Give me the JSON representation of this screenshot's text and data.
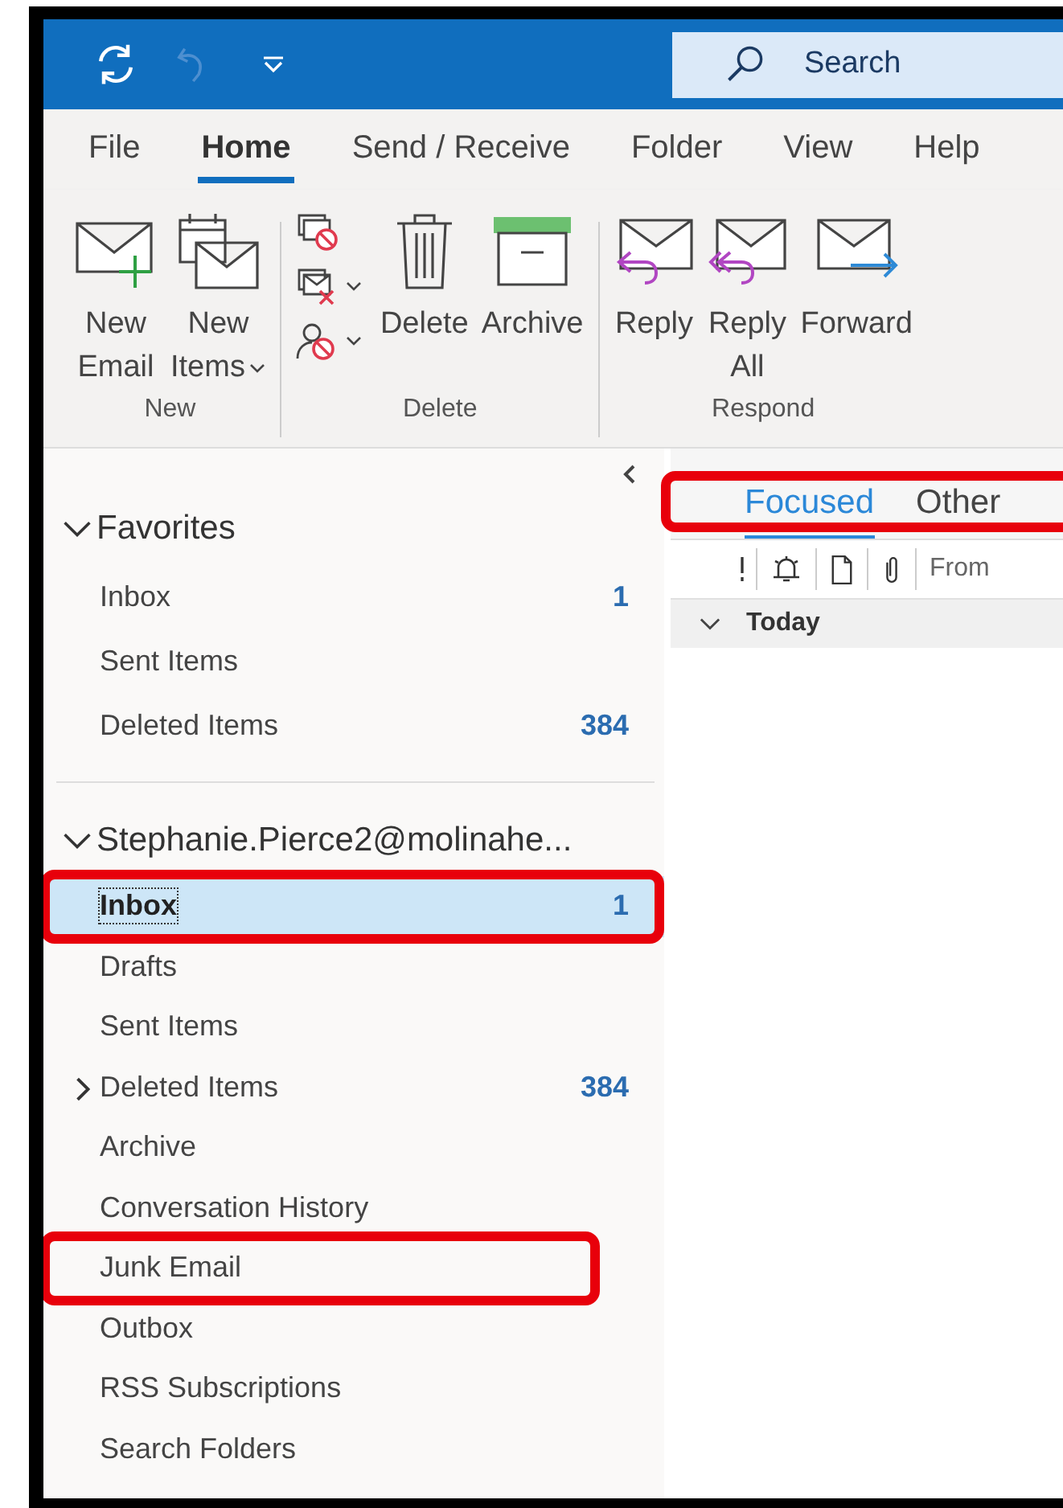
{
  "search": {
    "placeholder": "Search"
  },
  "menu_tabs": [
    {
      "label": "File",
      "selected": false
    },
    {
      "label": "Home",
      "selected": true
    },
    {
      "label": "Send / Receive",
      "selected": false
    },
    {
      "label": "Folder",
      "selected": false
    },
    {
      "label": "View",
      "selected": false
    },
    {
      "label": "Help",
      "selected": false
    }
  ],
  "ribbon": [
    {
      "label": "New",
      "buttons": [
        {
          "kind": "new-email",
          "lines": [
            "New",
            "Email"
          ],
          "dropdown": false
        },
        {
          "kind": "new-items",
          "lines": [
            "New",
            "Items"
          ],
          "dropdown": true
        }
      ]
    },
    {
      "label": "Delete",
      "small_buttons": [
        {
          "kind": "ignore",
          "dropdown": false
        },
        {
          "kind": "clean-up",
          "dropdown": true
        },
        {
          "kind": "block",
          "dropdown": true
        }
      ],
      "buttons": [
        {
          "kind": "delete",
          "lines": [
            "Delete"
          ],
          "dropdown": false
        },
        {
          "kind": "archive",
          "lines": [
            "Archive"
          ],
          "dropdown": false
        }
      ]
    },
    {
      "label": "Respond",
      "buttons": [
        {
          "kind": "reply",
          "lines": [
            "Reply"
          ],
          "dropdown": false
        },
        {
          "kind": "reply-all",
          "lines": [
            "Reply",
            "All"
          ],
          "dropdown": false
        },
        {
          "kind": "forward",
          "lines": [
            "Forward"
          ],
          "dropdown": false
        }
      ]
    }
  ],
  "favorites": {
    "label": "Favorites",
    "expanded": true,
    "items": [
      {
        "label": "Inbox",
        "count": "1",
        "selected": false,
        "highlighted": false
      },
      {
        "label": "Sent Items",
        "selected": false,
        "highlighted": false
      },
      {
        "label": "Deleted Items",
        "count": "384",
        "selected": false,
        "highlighted": false
      }
    ]
  },
  "account": {
    "label": "Stephanie.Pierce2@molinahe...",
    "expanded": true,
    "folders": [
      {
        "label": "Inbox",
        "count": "1",
        "selected": true,
        "highlighted": true,
        "has_subfolders": false
      },
      {
        "label": "Drafts",
        "selected": false,
        "highlighted": false,
        "has_subfolders": false
      },
      {
        "label": "Sent Items",
        "selected": false,
        "highlighted": false,
        "has_subfolders": false
      },
      {
        "label": "Deleted Items",
        "count": "384",
        "selected": false,
        "highlighted": false,
        "has_subfolders": true
      },
      {
        "label": "Archive",
        "selected": false,
        "highlighted": false,
        "has_subfolders": false
      },
      {
        "label": "Conversation History",
        "selected": false,
        "highlighted": false,
        "has_subfolders": false
      },
      {
        "label": "Junk Email",
        "selected": false,
        "highlighted": true,
        "has_subfolders": false
      },
      {
        "label": "Outbox",
        "selected": false,
        "highlighted": false,
        "has_subfolders": false
      },
      {
        "label": "RSS Subscriptions",
        "selected": false,
        "highlighted": false,
        "has_subfolders": false
      },
      {
        "label": "Search Folders",
        "selected": false,
        "highlighted": false,
        "has_subfolders": false
      }
    ]
  },
  "message_list": {
    "tabs_highlighted": true,
    "tabs": [
      {
        "label": "Focused",
        "selected": true
      },
      {
        "label": "Other",
        "selected": false
      }
    ],
    "columns": [
      {
        "kind": "importance"
      },
      {
        "kind": "reminder"
      },
      {
        "kind": "item-type"
      },
      {
        "kind": "attachment"
      },
      {
        "kind": "text",
        "label": "From"
      }
    ],
    "groups": [
      {
        "label": "Today",
        "expanded": true
      }
    ]
  }
}
